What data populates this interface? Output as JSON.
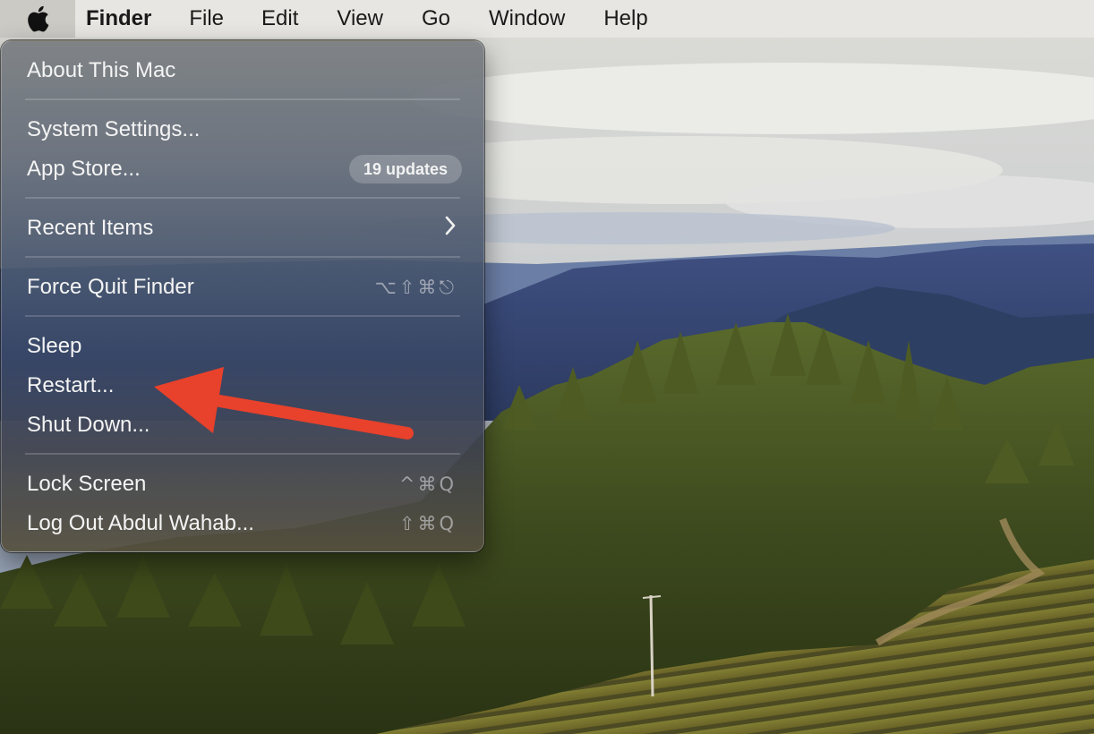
{
  "menubar": {
    "apple_icon": "apple-logo-icon",
    "app_name": "Finder",
    "menus": [
      "File",
      "Edit",
      "View",
      "Go",
      "Window",
      "Help"
    ]
  },
  "apple_menu": {
    "items": {
      "about": "About This Mac",
      "system_settings": "System Settings...",
      "app_store": "App Store...",
      "app_store_badge": "19 updates",
      "recent_items": "Recent Items",
      "recent_items_icon": "chevron-right-icon",
      "force_quit": "Force Quit Finder",
      "force_quit_shortcut": "⌥⇧⌘⎋",
      "sleep": "Sleep",
      "restart": "Restart...",
      "shut_down": "Shut Down...",
      "lock_screen": "Lock Screen",
      "lock_screen_shortcut": "^⌘Q",
      "log_out": "Log Out Abdul Wahab...",
      "log_out_shortcut": "⇧⌘Q"
    }
  },
  "annotation": {
    "arrow_color": "#e8412c",
    "arrow_icon": "red-arrow-pointing-left"
  },
  "colors": {
    "menubar_bg": "#e8e6e2",
    "menu_text": "#f4f4f4"
  }
}
